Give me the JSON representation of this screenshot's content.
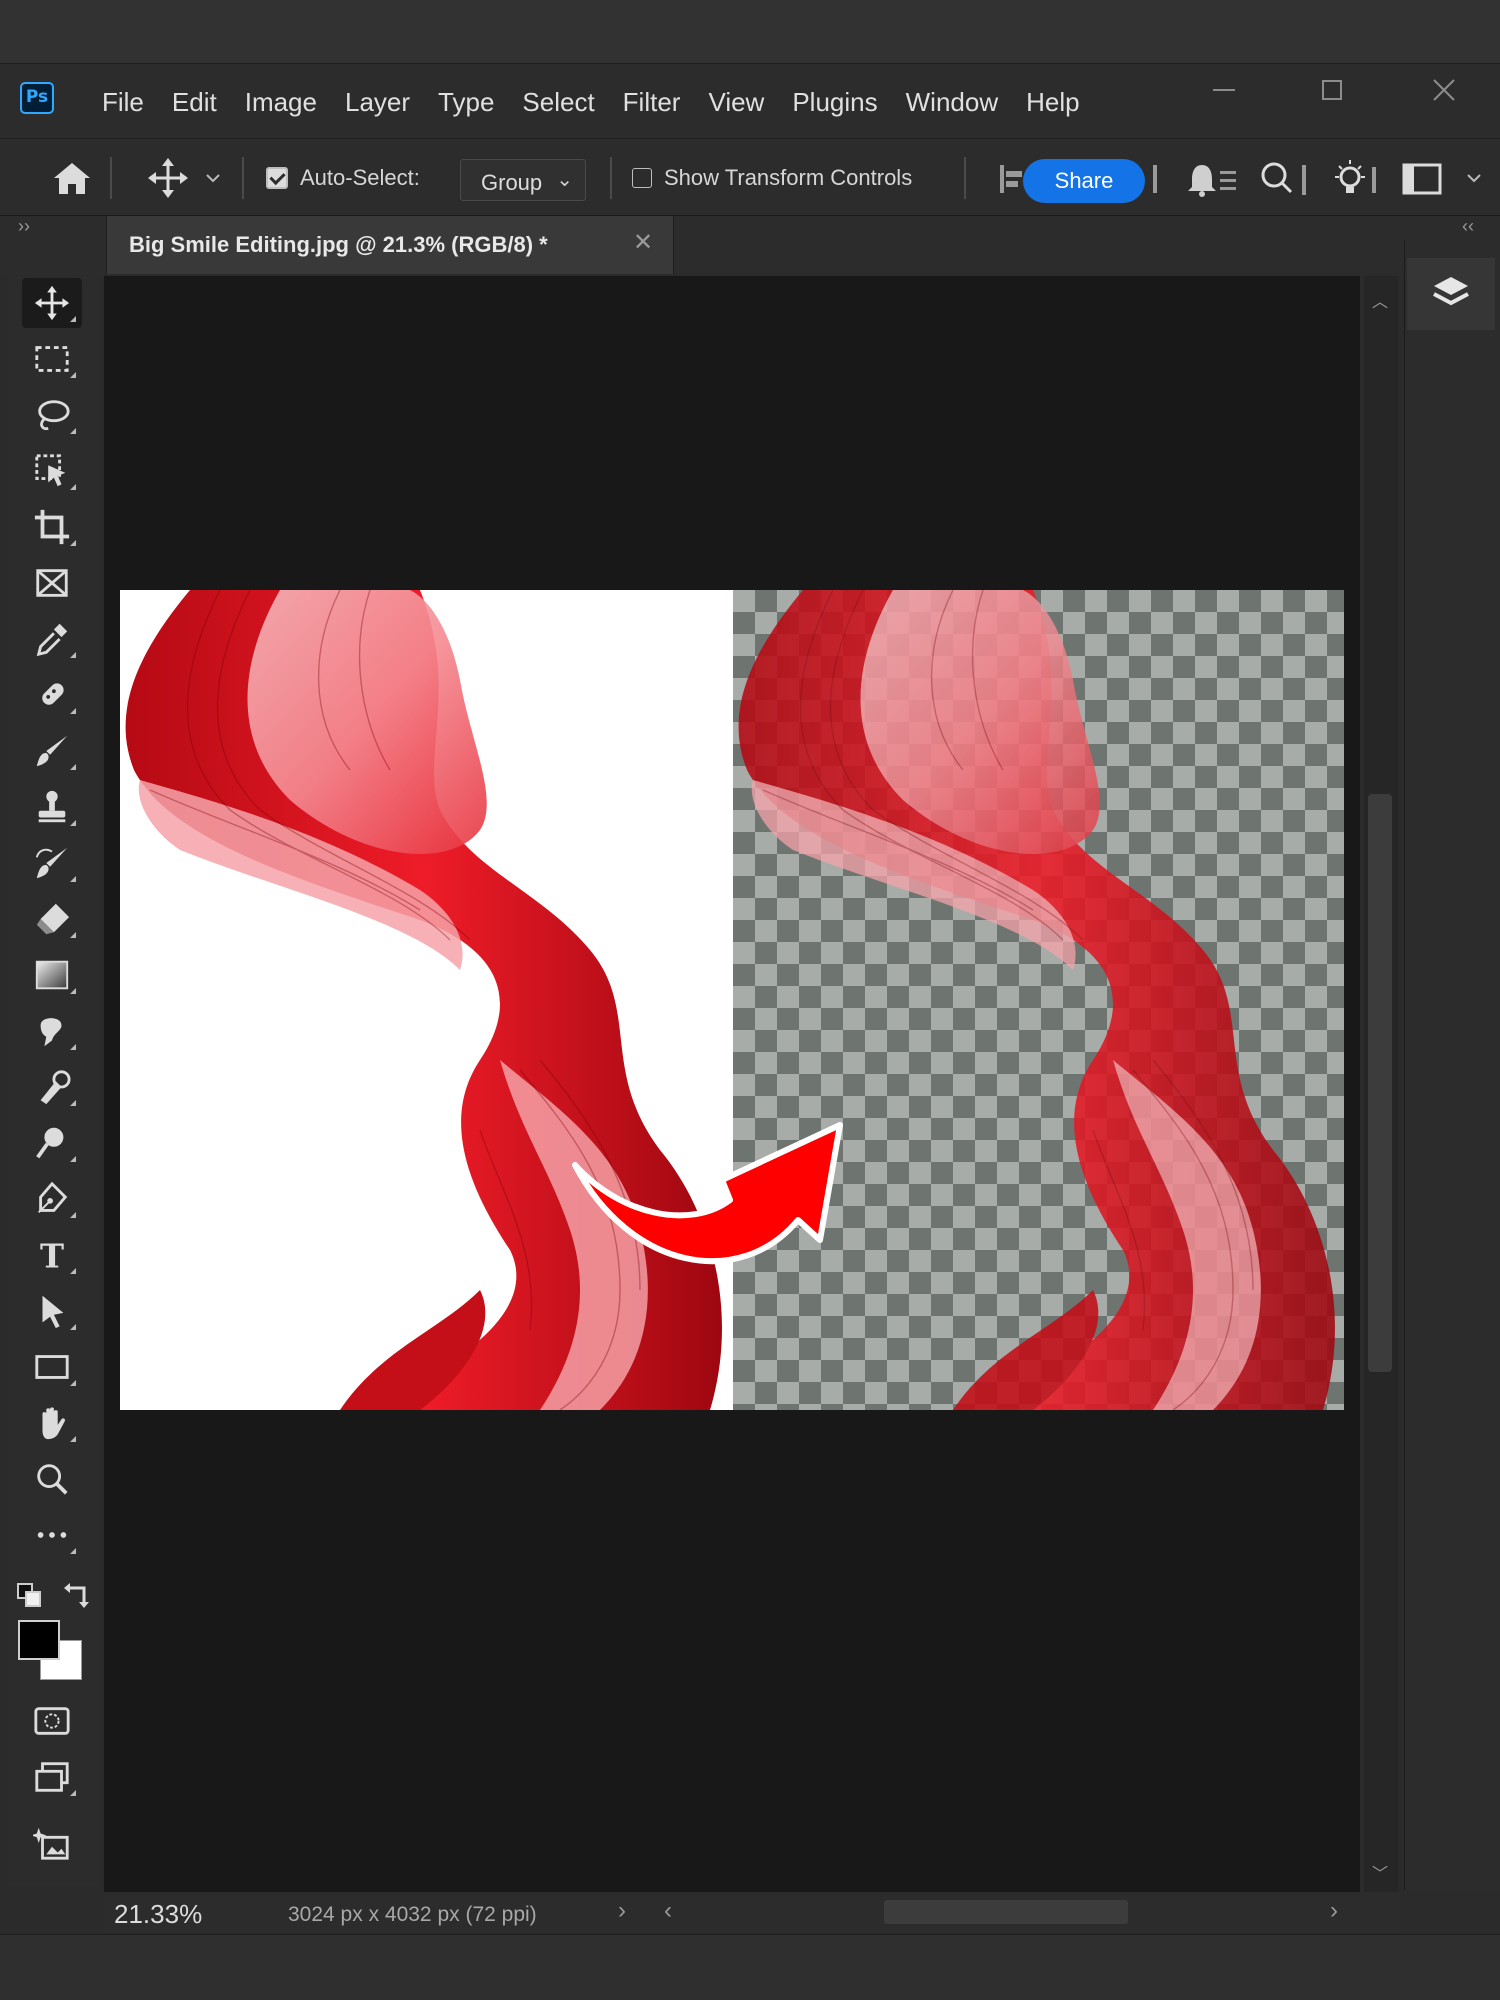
{
  "app": {
    "logo_text": "Ps"
  },
  "menu": [
    "File",
    "Edit",
    "Image",
    "Layer",
    "Type",
    "Select",
    "Filter",
    "View",
    "Plugins",
    "Window",
    "Help"
  ],
  "options_bar": {
    "auto_select_label": "Auto-Select:",
    "auto_select_checked": true,
    "auto_select_mode": "Group",
    "transform_controls_label": "Show Transform Controls",
    "transform_controls_checked": false,
    "share_label": "Share"
  },
  "document_tab": {
    "title": "Big Smile Editing.jpg @ 21.3% (RGB/8) *"
  },
  "status": {
    "zoom": "21.33%",
    "doc_info": "3024 px x 4032 px (72 ppi)"
  },
  "colors": {
    "foreground": "#000000",
    "background": "#ffffff",
    "accent": "#1473e6",
    "ribbon_red": "#e8141f"
  },
  "tools": [
    "move-tool",
    "rectangular-marquee-tool",
    "lasso-tool",
    "object-selection-tool",
    "crop-tool",
    "frame-tool",
    "eyedropper-tool",
    "spot-healing-brush-tool",
    "brush-tool",
    "clone-stamp-tool",
    "history-brush-tool",
    "eraser-tool",
    "gradient-tool",
    "smudge-tool",
    "burn-tool",
    "dodge-tool",
    "pen-tool",
    "type-tool",
    "path-selection-tool",
    "rectangle-tool",
    "hand-tool",
    "zoom-tool",
    "more-tools"
  ]
}
